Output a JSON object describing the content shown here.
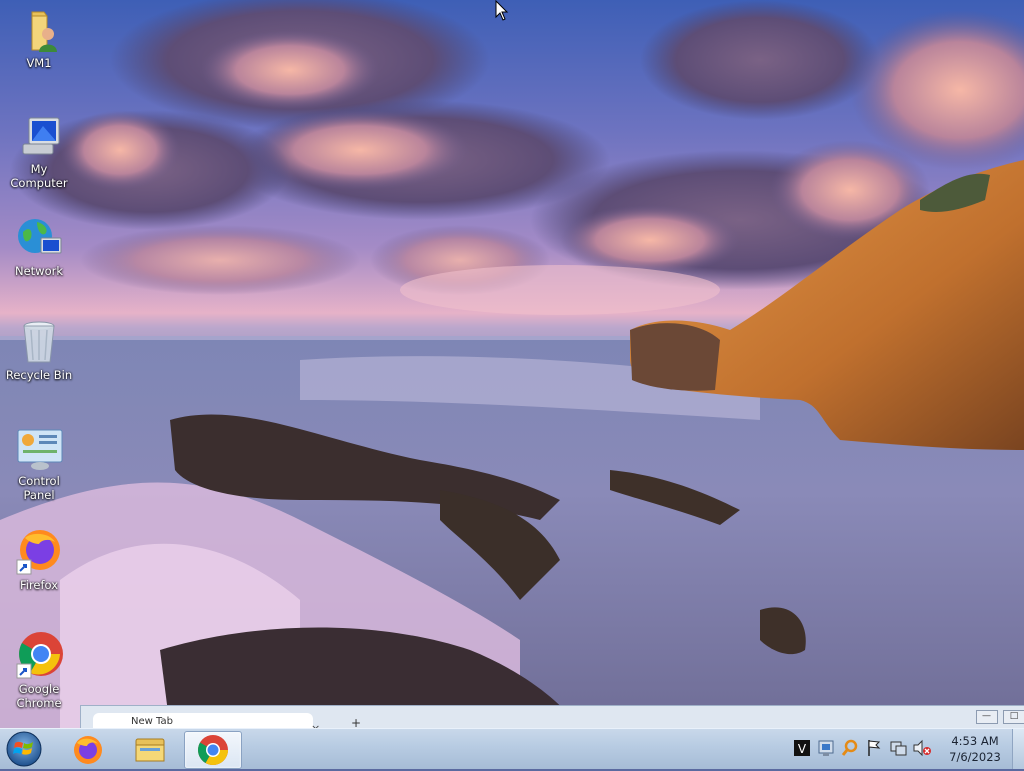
{
  "desktop": {
    "icons": [
      {
        "label": "VM1",
        "icon": "user-folder-icon"
      },
      {
        "label": "My Computer",
        "icon": "computer-icon"
      },
      {
        "label": "Network",
        "icon": "network-icon"
      },
      {
        "label": "Recycle Bin",
        "icon": "recycle-bin-icon"
      },
      {
        "label": "Control Panel",
        "icon": "control-panel-icon"
      },
      {
        "label": "Firefox",
        "icon": "firefox-icon"
      },
      {
        "label": "Google Chrome",
        "icon": "chrome-icon"
      }
    ]
  },
  "browser_window": {
    "tab_title": "New Tab",
    "tab_close": "×",
    "new_tab": "+",
    "minimize": "—",
    "maximize": "□"
  },
  "taskbar": {
    "start_icon": "windows-logo-icon",
    "pinned": [
      {
        "name": "Firefox",
        "icon": "firefox-icon",
        "active": false
      },
      {
        "name": "Windows Explorer",
        "icon": "explorer-folder-icon",
        "active": false
      },
      {
        "name": "Google Chrome",
        "icon": "chrome-icon",
        "active": true
      }
    ],
    "tray_icons": [
      "keyboard-icon",
      "network-tray-icon",
      "search-tray-icon",
      "action-center-flag-icon",
      "network-status-icon",
      "volume-muted-icon"
    ],
    "clock": {
      "time": "4:53 AM",
      "date": "7/6/2023"
    }
  }
}
